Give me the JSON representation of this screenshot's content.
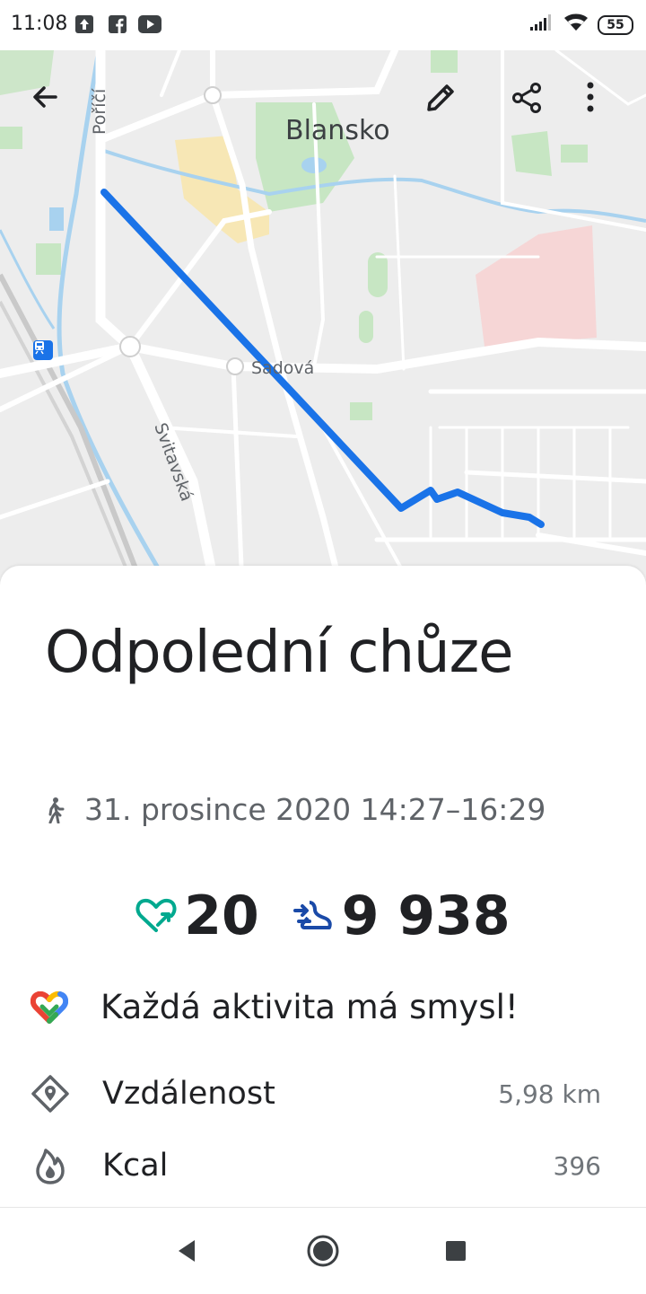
{
  "status_bar": {
    "time": "11:08",
    "battery": "55",
    "left_icons": [
      "upload-icon",
      "facebook-icon",
      "youtube-icon"
    ],
    "right_icons": [
      "signal-icon",
      "wifi-icon",
      "battery-icon"
    ]
  },
  "map": {
    "labels": {
      "town": "Blansko",
      "street_porici": "Poříčí",
      "street_sadova": "Sadová",
      "street_svitavska": "Svitavská"
    },
    "route_color": "#1a73e8"
  },
  "toolbar": {
    "back_icon": "arrow-back-icon",
    "edit_icon": "pencil-icon",
    "share_icon": "share-icon",
    "more_icon": "more-vert-icon"
  },
  "activity": {
    "title": "Odpolední chůze",
    "date_range": "31. prosince 2020 14:27–16:29",
    "heart_points": "20",
    "steps": "9 938",
    "heart_color": "#00a98f",
    "steps_color": "#1a4aa8"
  },
  "motto": "Každá aktivita má smysl!",
  "metrics": [
    {
      "label": "Vzdálenost",
      "value": "5,98 km",
      "icon": "location-diamond-icon"
    },
    {
      "label": "Kcal",
      "value": "396",
      "icon": "flame-icon"
    }
  ],
  "nav": {
    "back_icon": "nav-back-icon",
    "home_icon": "nav-home-icon",
    "recents_icon": "nav-recents-icon"
  }
}
